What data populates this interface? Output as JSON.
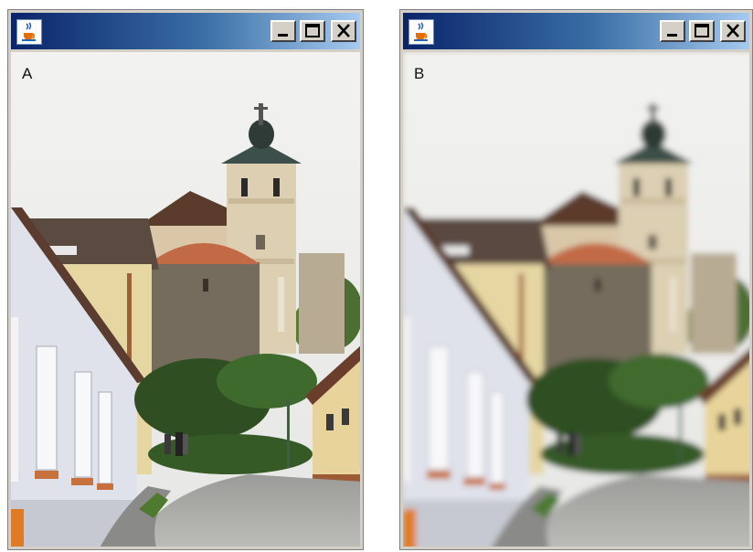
{
  "windows": [
    {
      "id": "a",
      "label": "A",
      "title_icon": "java-cup-icon",
      "controls": [
        "minimize-icon",
        "maximize-icon",
        "close-icon"
      ],
      "image": {
        "subject": "photo",
        "blurred": false
      }
    },
    {
      "id": "b",
      "label": "B",
      "title_icon": "java-cup-icon",
      "controls": [
        "minimize-icon",
        "maximize-icon",
        "close-icon"
      ],
      "image": {
        "subject": "photo",
        "blurred": true
      }
    }
  ],
  "colors": {
    "titlebar_start": "#0a246a",
    "titlebar_end": "#a6caf0",
    "window_frame": "#d4d0c8",
    "sky": "#eeeeec"
  }
}
